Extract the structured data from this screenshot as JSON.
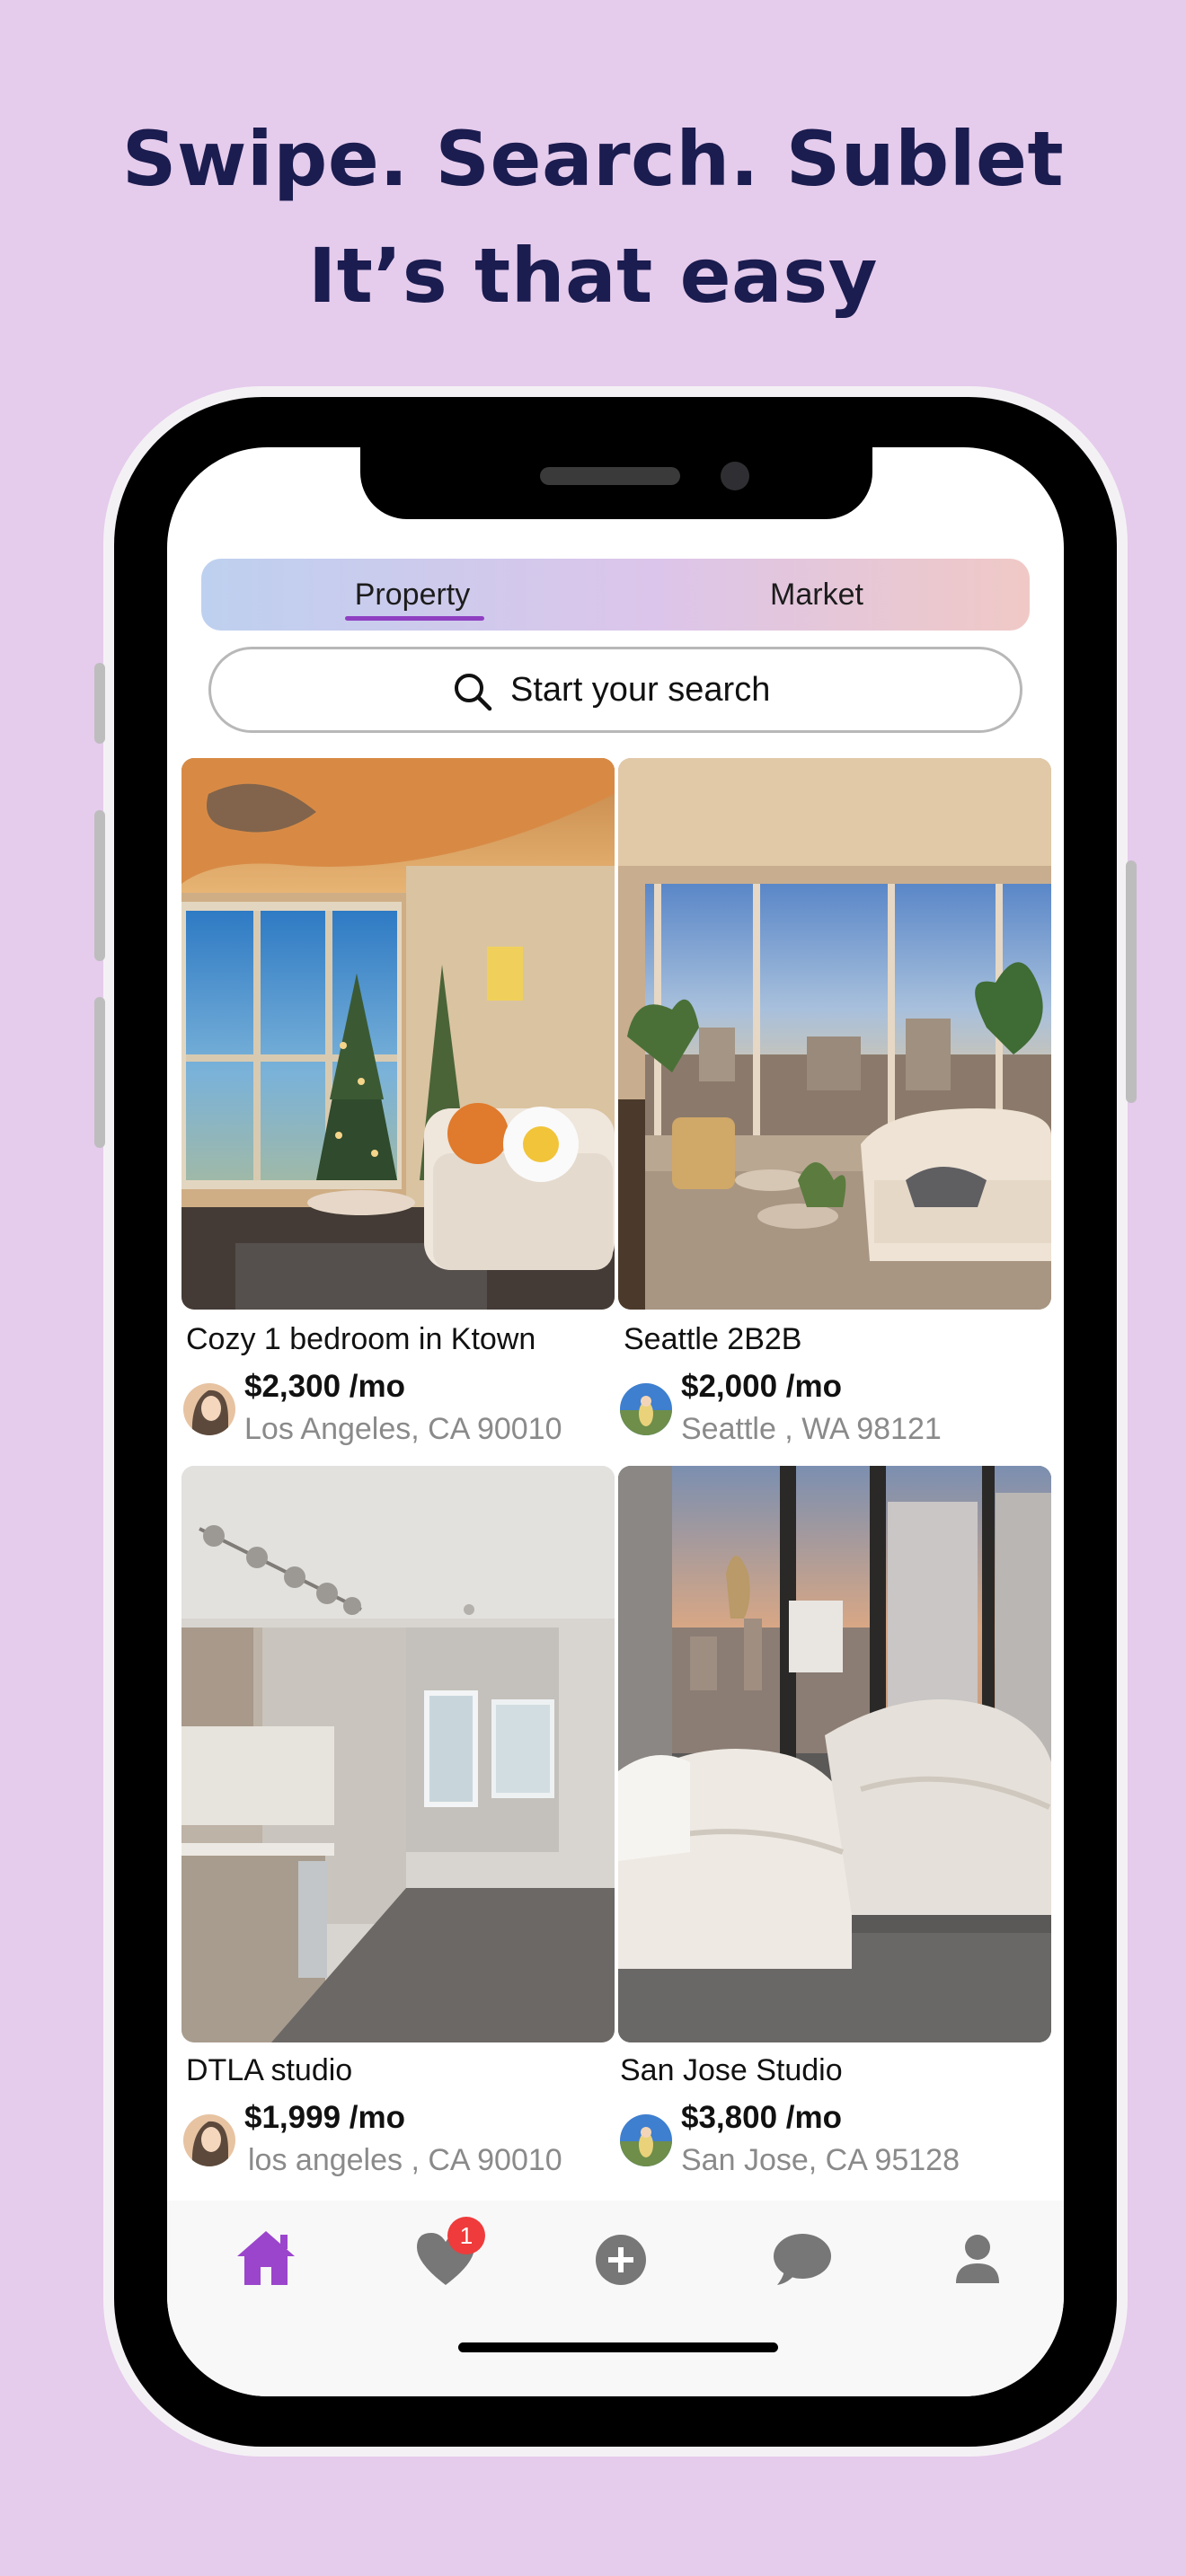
{
  "headline": {
    "line1": "Swipe. Search. Sublet",
    "line2": "It’s that easy"
  },
  "tabs": {
    "property": "Property",
    "market": "Market",
    "active": "Property"
  },
  "search": {
    "placeholder": "Start your search",
    "icon": "search-icon"
  },
  "listings": [
    {
      "title": "Cozy 1 bedroom in Ktown",
      "price": "$2,300 /mo",
      "location": "Los Angeles, CA 90010"
    },
    {
      "title": "Seattle 2B2B",
      "price": "$2,000 /mo",
      "location": "Seattle , WA 98121"
    },
    {
      "title": "DTLA studio",
      "price": "$1,999 /mo",
      "location": "los angeles , CA 90010"
    },
    {
      "title": "San Jose Studio",
      "price": "$3,800 /mo",
      "location": "San Jose, CA 95128"
    }
  ],
  "nav": {
    "items": [
      "home-icon",
      "heart-icon",
      "plus-circle-icon",
      "chat-bubble-icon",
      "profile-icon"
    ],
    "active": "home-icon",
    "favorites_badge": "1"
  },
  "colors": {
    "background": "#e5cbec",
    "headline": "#1b1c4f",
    "accent": "#8f3fc2",
    "badge": "#ef3b3b"
  }
}
